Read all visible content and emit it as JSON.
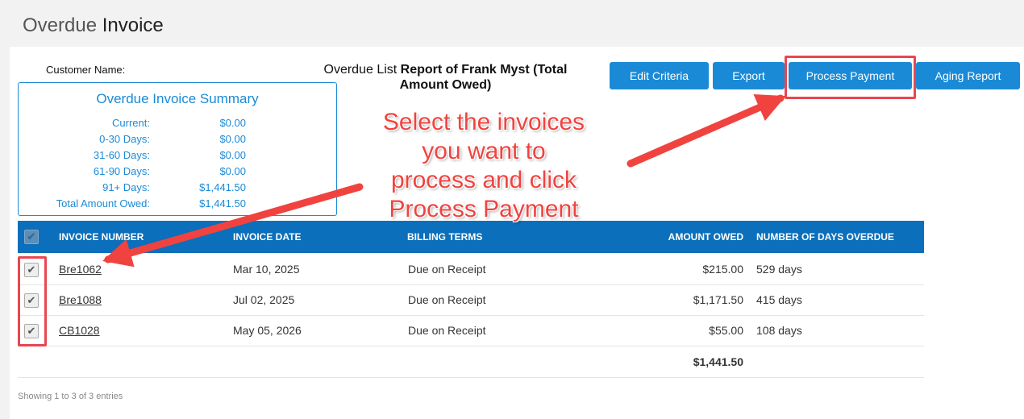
{
  "page": {
    "title_light": "Overdue",
    "title_bold": "Invoice"
  },
  "header": {
    "customer_label": "Customer Name:",
    "report_prefix": "Overdue List ",
    "report_bold": "Report of Frank Myst (Total Amount Owed)"
  },
  "buttons": {
    "edit_criteria": "Edit Criteria",
    "export": "Export",
    "process_payment": "Process Payment",
    "aging_report": "Aging Report"
  },
  "summary": {
    "title": "Overdue Invoice Summary",
    "rows": [
      {
        "label": "Current:",
        "value": "$0.00"
      },
      {
        "label": "0-30 Days:",
        "value": "$0.00"
      },
      {
        "label": "31-60 Days:",
        "value": "$0.00"
      },
      {
        "label": "61-90 Days:",
        "value": "$0.00"
      },
      {
        "label": "91+ Days:",
        "value": "$1,441.50"
      },
      {
        "label": "Total Amount Owed:",
        "value": "$1,441.50"
      }
    ]
  },
  "table": {
    "columns": {
      "invoice_number": "INVOICE NUMBER",
      "invoice_date": "INVOICE DATE",
      "billing_terms": "BILLING TERMS",
      "amount_owed": "AMOUNT OWED",
      "days_overdue": "NUMBER OF DAYS OVERDUE"
    },
    "rows": [
      {
        "checked": true,
        "invoice": "Bre1062",
        "date": "Mar 10, 2025",
        "terms": "Due on Receipt",
        "amount": "$215.00",
        "days": "529 days"
      },
      {
        "checked": true,
        "invoice": "Bre1088",
        "date": "Jul 02, 2025",
        "terms": "Due on Receipt",
        "amount": "$1,171.50",
        "days": "415 days"
      },
      {
        "checked": true,
        "invoice": "CB1028",
        "date": "May 05, 2026",
        "terms": "Due on Receipt",
        "amount": "$55.00",
        "days": "108 days"
      }
    ],
    "total": "$1,441.50",
    "footer": "Showing 1 to 3 of 3 entries"
  },
  "annotation": {
    "line1": "Select the invoices",
    "line2": "you want to",
    "line3": "process and click",
    "line4": "Process Payment",
    "color": "#f0433f"
  },
  "colors": {
    "primary": "#1b8ad6",
    "header_bg": "#0b6fbb",
    "highlight": "#e8474f"
  },
  "icons": {
    "checkbox": "check-icon"
  }
}
